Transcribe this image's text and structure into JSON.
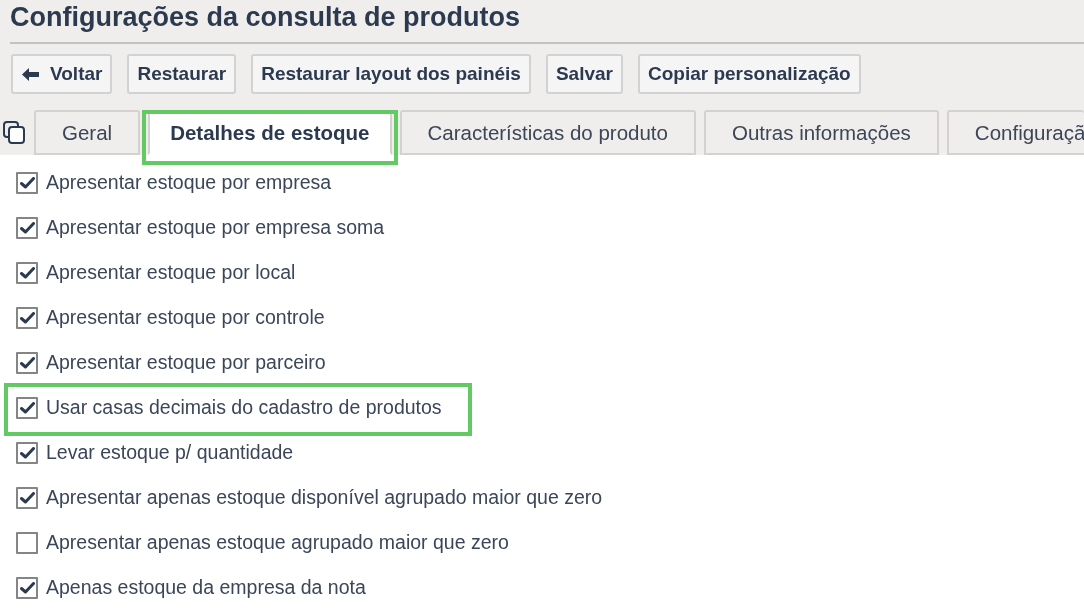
{
  "title": "Configurações da consulta de produtos",
  "toolbar": [
    {
      "label": "Voltar",
      "kind": "back"
    },
    {
      "label": "Restaurar",
      "kind": "plain"
    },
    {
      "label": "Restaurar layout dos painéis",
      "kind": "plain"
    },
    {
      "label": "Salvar",
      "kind": "plain"
    },
    {
      "label": "Copiar personalização",
      "kind": "plain"
    }
  ],
  "tabs": [
    {
      "label": "Geral",
      "selected": false,
      "highlighted": false
    },
    {
      "label": "Detalhes de estoque",
      "selected": true,
      "highlighted": true
    },
    {
      "label": "Características do produto",
      "selected": false,
      "highlighted": false
    },
    {
      "label": "Outras informações",
      "selected": false,
      "highlighted": false
    },
    {
      "label": "Configuraçã",
      "selected": false,
      "highlighted": false
    }
  ],
  "options": [
    {
      "label": "Apresentar estoque por empresa",
      "checked": true,
      "highlighted": false
    },
    {
      "label": "Apresentar estoque por empresa soma",
      "checked": true,
      "highlighted": false
    },
    {
      "label": "Apresentar estoque por local",
      "checked": true,
      "highlighted": false
    },
    {
      "label": "Apresentar estoque por controle",
      "checked": true,
      "highlighted": false
    },
    {
      "label": "Apresentar estoque por parceiro",
      "checked": true,
      "highlighted": false
    },
    {
      "label": "Usar casas decimais do cadastro de produtos",
      "checked": true,
      "highlighted": true
    },
    {
      "label": "Levar estoque p/ quantidade",
      "checked": true,
      "highlighted": false
    },
    {
      "label": "Apresentar apenas estoque disponível agrupado maior que zero",
      "checked": true,
      "highlighted": false
    },
    {
      "label": "Apresentar apenas estoque agrupado maior que zero",
      "checked": false,
      "highlighted": false
    },
    {
      "label": "Apenas estoque da empresa da nota",
      "checked": true,
      "highlighted": false
    }
  ]
}
